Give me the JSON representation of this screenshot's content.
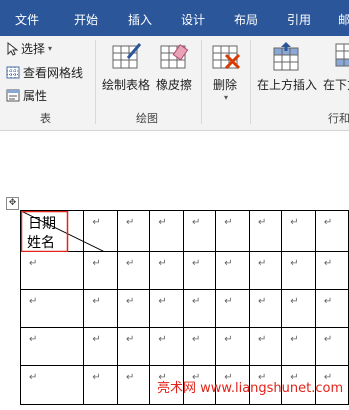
{
  "tabs": [
    "文件",
    "开始",
    "插入",
    "设计",
    "布局",
    "引用",
    "邮"
  ],
  "ribbon": {
    "table_group": {
      "select_label": "选择",
      "gridlines_label": "查看网格线",
      "properties_label": "属性",
      "group_label": "表"
    },
    "draw_group": {
      "draw_table_label": "绘制表格",
      "eraser_label": "橡皮擦",
      "group_label": "绘图"
    },
    "rows_group": {
      "delete_label": "删除",
      "insert_above_label": "在上方插入",
      "insert_below_label": "在下方",
      "group_label": "行和"
    }
  },
  "document": {
    "first_cell_top": "日期",
    "first_cell_bottom": "姓名",
    "paragraph_mark": "↵",
    "rows": 5,
    "cols": 9
  },
  "watermark": "亮术网 www.liangshunet.com",
  "colors": {
    "tab_bar": "#2b579a",
    "ribbon_bg": "#f3f3f3",
    "highlight": "#e2241a"
  }
}
